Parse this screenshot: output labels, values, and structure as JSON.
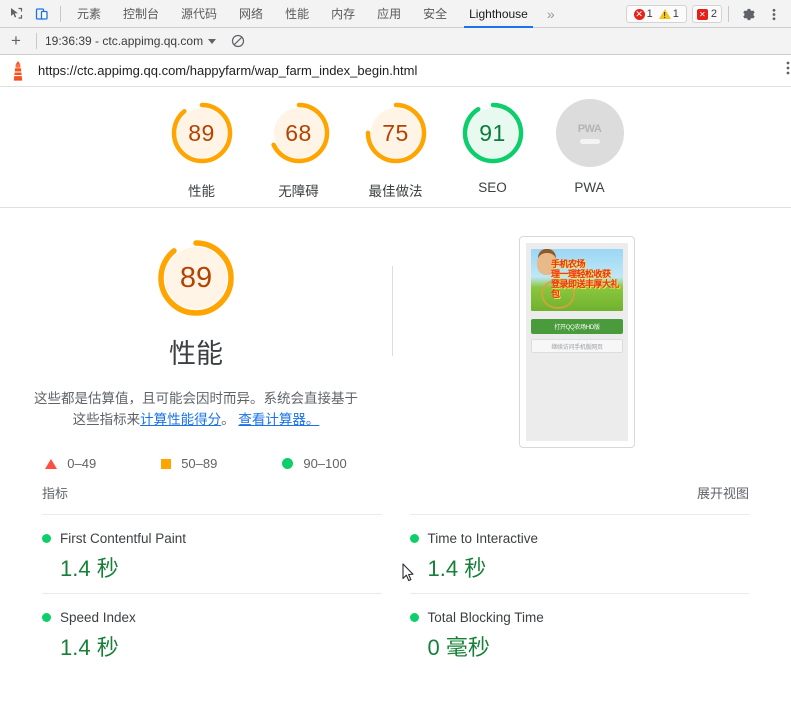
{
  "devtools": {
    "icons": {
      "inspect": "inspect-element-icon",
      "device": "device-toolbar-icon",
      "gear": "settings-gear-icon",
      "kebab": "more-options-icon",
      "overflow": "tabs-overflow-icon"
    },
    "tabs": [
      {
        "label": "元素",
        "active": false
      },
      {
        "label": "控制台",
        "active": false
      },
      {
        "label": "源代码",
        "active": false
      },
      {
        "label": "网络",
        "active": false
      },
      {
        "label": "性能",
        "active": false
      },
      {
        "label": "内存",
        "active": false
      },
      {
        "label": "应用",
        "active": false
      },
      {
        "label": "安全",
        "active": false
      },
      {
        "label": "Lighthouse",
        "active": true
      }
    ],
    "overflow_label": "»",
    "badges": {
      "errors": "1",
      "warnings": "1",
      "violations": "2",
      "violation_glyph": "✖"
    }
  },
  "run_bar": {
    "add_label": "+",
    "run_title": "19:36:39 - ctc.appimg.qq.com",
    "clear_icon": "clear-all-icon"
  },
  "url_bar": {
    "logo_icon": "lighthouse-logo-icon",
    "url": "https://ctc.appimg.qq.com/happyfarm/wap_farm_index_begin.html",
    "menu_icon": "more-options-icon"
  },
  "colors": {
    "orange": "#ffa400",
    "orange_fill": "#fff4e5",
    "orange_text": "#b34300",
    "green": "#0cce6b",
    "green_fill": "#e8faf0",
    "green_text": "#0b7c3f",
    "red": "#ff4e42",
    "gray": "#dcdcdc",
    "link": "#1a73e8"
  },
  "gauges": [
    {
      "score": "89",
      "label": "性能",
      "tone": "orange"
    },
    {
      "score": "68",
      "label": "无障碍",
      "tone": "orange"
    },
    {
      "score": "75",
      "label": "最佳做法",
      "tone": "orange"
    },
    {
      "score": "91",
      "label": "SEO",
      "tone": "green"
    },
    {
      "score": "",
      "label": "PWA",
      "tone": "gray",
      "inner_text": "PWA"
    }
  ],
  "hero": {
    "score": "89",
    "title": "性能",
    "desc_part1": "这些都是估算值，且可能会因时而异。系统会直接基于这些指标来",
    "desc_link1": "计算性能得分",
    "desc_part2": "。 ",
    "desc_link2": "查看计算器。",
    "legend": [
      {
        "range": "0–49",
        "shape": "triangle"
      },
      {
        "range": "50–89",
        "shape": "square"
      },
      {
        "range": "90–100",
        "shape": "circle"
      }
    ]
  },
  "thumbnail": {
    "banner_lines": [
      "手机农场",
      "理一理轻松收获",
      "登录即送丰厚大礼包"
    ],
    "button_primary": "打开QQ农场HD版",
    "button_secondary": "继续访问手机版网页"
  },
  "metrics": {
    "header": "指标",
    "expand_label": "展开视图",
    "items": [
      {
        "name": "First Contentful Paint",
        "value": "1.4 秒",
        "status": "green"
      },
      {
        "name": "Time to Interactive",
        "value": "1.4 秒",
        "status": "green"
      },
      {
        "name": "Speed Index",
        "value": "1.4 秒",
        "status": "green"
      },
      {
        "name": "Total Blocking Time",
        "value": "0 毫秒",
        "status": "green"
      }
    ]
  }
}
